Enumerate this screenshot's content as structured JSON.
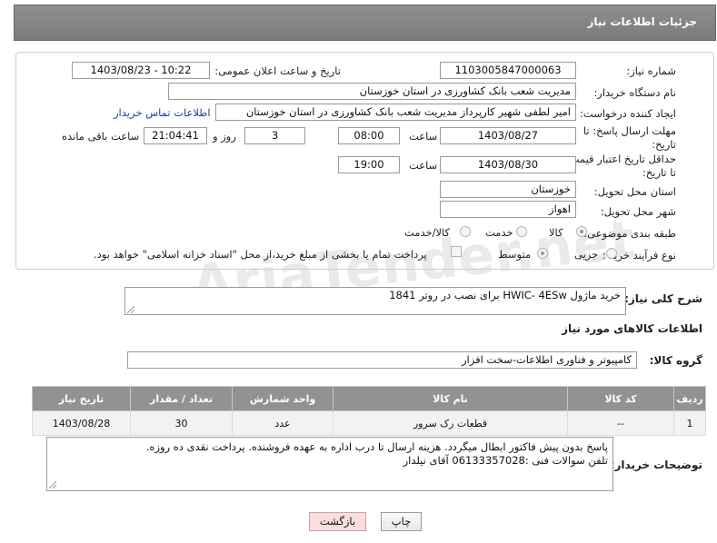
{
  "header": {
    "title": "جزئیات اطلاعات نیاز"
  },
  "form": {
    "need_number_label": "شماره نیاز:",
    "need_number": "1103005847000063",
    "announce_label": "تاریخ و ساعت اعلان عمومی:",
    "announce_value": "1403/08/23 - 10:22",
    "buyer_org_label": "نام دستگاه خریدار:",
    "buyer_org": "مدیریت شعب بانک کشاورزی در استان خوزستان",
    "creator_label": "ایجاد کننده درخواست:",
    "creator": "امیر لطفی شهیر کارپرداز مدیریت شعب بانک کشاورزی در استان خوزستان",
    "contact_link": "اطلاعات تماس خریدار",
    "deadline_label": "مهلت ارسال پاسخ: تا تاریخ:",
    "deadline_date": "1403/08/27",
    "time_label": "ساعت",
    "deadline_time": "08:00",
    "days_value": "3",
    "days_label": "روز و",
    "remaining_time": "21:04:41",
    "remaining_label": "ساعت باقی مانده",
    "validity_label": "حداقل تاریخ اعتبار قیمت: تا تاریخ:",
    "validity_date": "1403/08/30",
    "validity_time": "19:00",
    "province_label": "استان محل تحویل:",
    "province": "خوزستان",
    "city_label": "شهر محل تحویل:",
    "city": "اهواز",
    "category_label": "طبقه بندی موضوعی:",
    "category_options": [
      "کالا",
      "خدمت",
      "کالا/خدمت"
    ],
    "process_label": "نوع فرآیند خرید :",
    "process_options": [
      "جزیی",
      "متوسط"
    ],
    "treasury_text": "پرداخت تمام یا بخشی از مبلغ خرید،از محل \"اسناد خزانه اسلامی\" خواهد بود."
  },
  "description": {
    "label": "شرح کلی نیاز:",
    "value": "خرید ماژول HWIC- 4ESw برای نصب در روتر 1841"
  },
  "goods_section": {
    "title": "اطلاعات کالاهای مورد نیاز",
    "group_label": "گروه کالا:",
    "group_value": "کامپیوتر و فناوری اطلاعات-سخت افزار"
  },
  "table": {
    "headers": [
      "ردیف",
      "کد کالا",
      "نام کالا",
      "واحد شمارش",
      "تعداد / مقدار",
      "تاریخ نیاز"
    ],
    "rows": [
      [
        "1",
        "--",
        "قطعات رک سرور",
        "عدد",
        "30",
        "1403/08/28"
      ]
    ]
  },
  "buyer_notes": {
    "label": "توضیحات خریدار:",
    "line1": "پاسخ بدون پیش فاکتور ابطال میگردد. هزینه ارسال تا درب اداره به عهده فروشنده. پرداخت نقدی ده روزه.",
    "line2": "تلفن سوالات فنی :06133357028 آقای نیلدار"
  },
  "buttons": {
    "print": "چاپ",
    "back": "بازگشت"
  },
  "watermark": "AriaTender.net",
  "colors": {
    "header_bg": "#808080",
    "link": "#1f3f9f",
    "back_button_bg": "#f9dede"
  }
}
